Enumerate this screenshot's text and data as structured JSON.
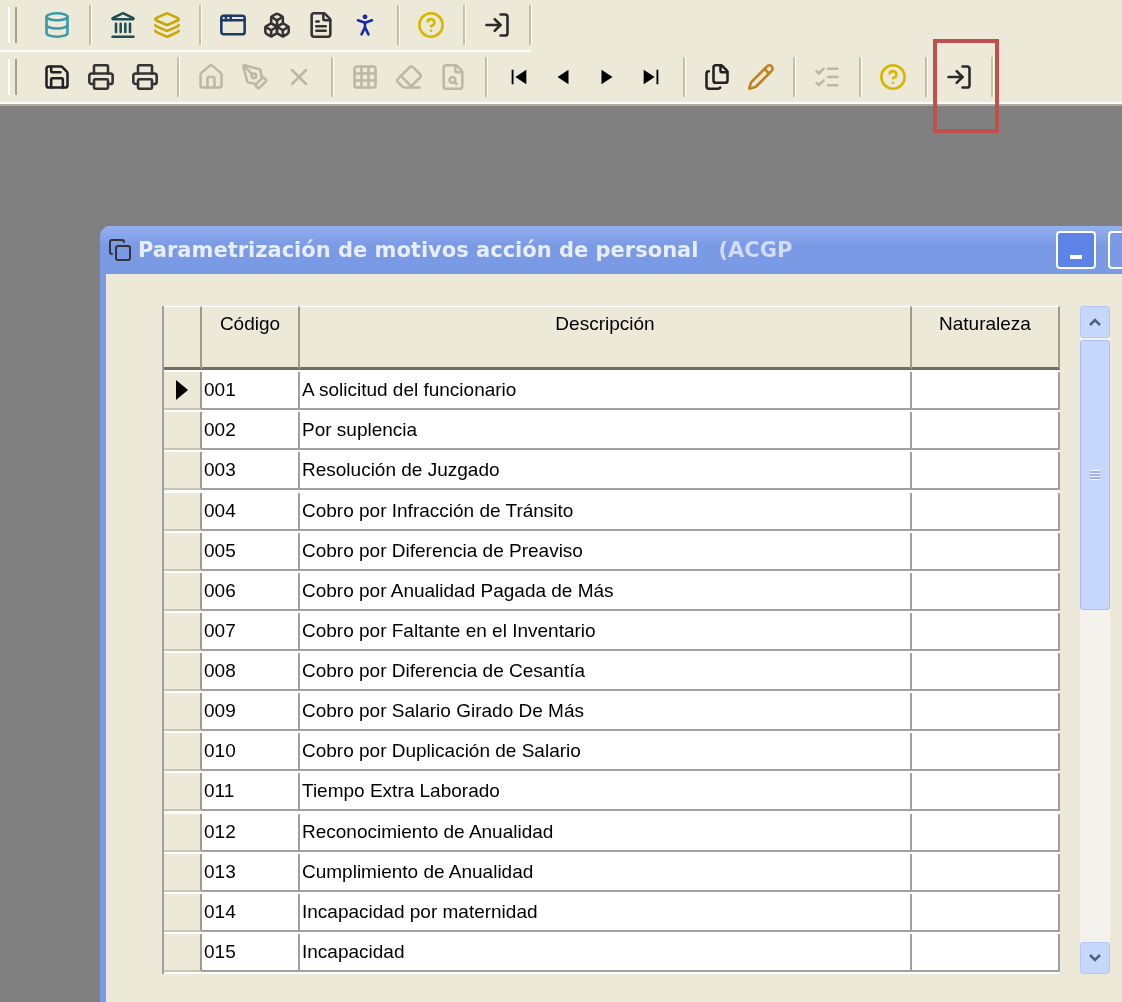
{
  "toolbar_top": {
    "groups": [
      [
        {
          "disabled": false
        }
      ],
      [
        {
          "disabled": false
        },
        {
          "disabled": false
        }
      ],
      [
        {
          "disabled": false
        },
        {
          "disabled": false
        },
        {
          "disabled": false
        },
        {
          "disabled": false
        }
      ],
      [
        {
          "disabled": false
        }
      ],
      [
        {
          "disabled": false
        }
      ]
    ]
  },
  "toolbar_bottom": {
    "groups": [
      [
        {
          "disabled": false
        },
        {
          "disabled": false
        },
        {
          "disabled": false
        }
      ],
      [
        {
          "disabled": true
        },
        {
          "disabled": true
        },
        {
          "disabled": true
        }
      ],
      [
        {
          "disabled": true
        },
        {
          "disabled": true
        },
        {
          "disabled": true
        }
      ],
      [
        {
          "disabled": false
        },
        {
          "disabled": false
        },
        {
          "disabled": false
        },
        {
          "disabled": false
        }
      ],
      [
        {
          "disabled": false
        },
        {
          "disabled": false
        }
      ],
      [
        {
          "disabled": true
        }
      ],
      [
        {
          "disabled": false
        }
      ],
      [
        {
          "disabled": false,
          "highlighted": true
        }
      ]
    ]
  },
  "window": {
    "title": "Parametrización de motivos acción de personal",
    "title_faded": "(ACGP"
  },
  "table": {
    "columns": [
      "Código",
      "Descripción",
      "Naturaleza"
    ],
    "rows": [
      {
        "code": "001",
        "description": "A solicitud del funcionario",
        "nature": "",
        "selected": true
      },
      {
        "code": "002",
        "description": "Por suplencia",
        "nature": "",
        "selected": false
      },
      {
        "code": "003",
        "description": "Resolución de Juzgado",
        "nature": "",
        "selected": false
      },
      {
        "code": "004",
        "description": "Cobro por Infracción de Tránsito",
        "nature": "",
        "selected": false
      },
      {
        "code": "005",
        "description": "Cobro por Diferencia de Preaviso",
        "nature": "",
        "selected": false
      },
      {
        "code": "006",
        "description": "Cobro por Anualidad Pagada de Más",
        "nature": "",
        "selected": false
      },
      {
        "code": "007",
        "description": "Cobro por Faltante en el Inventario",
        "nature": "",
        "selected": false
      },
      {
        "code": "008",
        "description": "Cobro por Diferencia de Cesantía",
        "nature": "",
        "selected": false
      },
      {
        "code": "009",
        "description": "Cobro por Salario Girado De Más",
        "nature": "",
        "selected": false
      },
      {
        "code": "010",
        "description": "Cobro por Duplicación de Salario",
        "nature": "",
        "selected": false
      },
      {
        "code": "011",
        "description": "Tiempo Extra Laborado",
        "nature": "",
        "selected": false
      },
      {
        "code": "012",
        "description": "Reconocimiento de Anualidad",
        "nature": "",
        "selected": false
      },
      {
        "code": "013",
        "description": "Cumplimiento de Anualidad",
        "nature": "",
        "selected": false
      },
      {
        "code": "014",
        "description": "Incapacidad por maternidad",
        "nature": "",
        "selected": false
      },
      {
        "code": "015",
        "description": "Incapacidad",
        "nature": "",
        "selected": false
      }
    ]
  }
}
